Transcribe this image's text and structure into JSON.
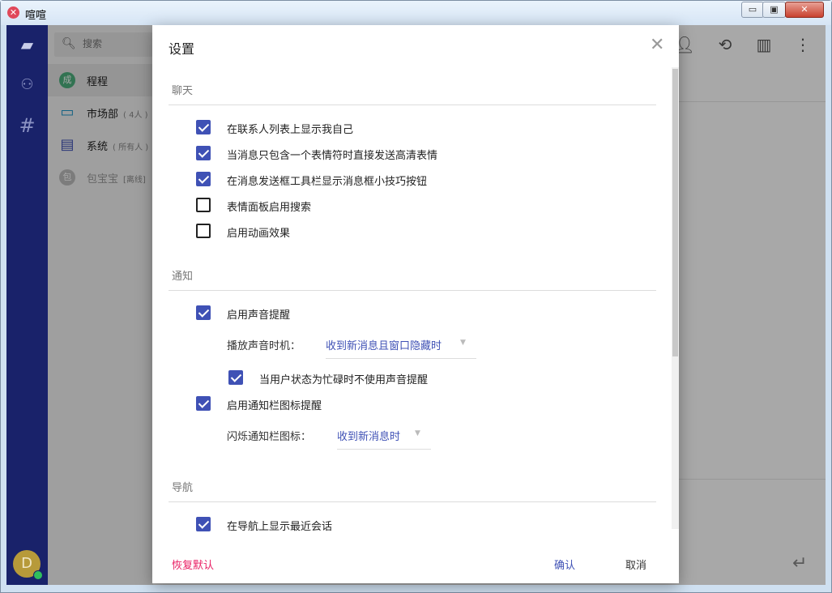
{
  "window": {
    "title": "喧喧",
    "logo": "x-close-icon"
  },
  "sidebar": {
    "items": [
      {
        "name": "chat",
        "icon": "chat-bubble-icon",
        "active": true
      },
      {
        "name": "contacts",
        "icon": "people-icon"
      },
      {
        "name": "channels",
        "icon": "hash-icon"
      }
    ],
    "avatar_letter": "D"
  },
  "chat_list": {
    "search_placeholder": "搜索",
    "items": [
      {
        "name": "程程",
        "avatar_text": "成",
        "avatar_color": "#4caf7d",
        "selected": true
      },
      {
        "name": "市场部",
        "sub": "( 4人 )",
        "icon": "group-chat-icon"
      },
      {
        "name": "系统",
        "sub": "( 所有人 )",
        "icon": "system-chat-icon"
      },
      {
        "name": "包宝宝",
        "sub": "[离线]",
        "avatar_text": "包",
        "avatar_color": "#bdbdbd"
      }
    ]
  },
  "dialog": {
    "title": "设置",
    "sections": [
      {
        "title": "聊天",
        "options": [
          {
            "label": "在联系人列表上显示我自己",
            "checked": true
          },
          {
            "label": "当消息只包含一个表情符时直接发送高清表情",
            "checked": true
          },
          {
            "label": "在消息发送框工具栏显示消息框小技巧按钮",
            "checked": true
          },
          {
            "label": "表情面板启用搜索",
            "checked": false
          },
          {
            "label": "启用动画效果",
            "checked": false
          }
        ]
      },
      {
        "title": "通知",
        "sound_enabled": {
          "label": "启用声音提醒",
          "checked": true
        },
        "sound_timing": {
          "label": "播放声音时机：",
          "value": "收到新消息且窗口隐藏时"
        },
        "busy_mute": {
          "label": "当用户状态为忙碌时不使用声音提醒",
          "checked": true
        },
        "tray_enabled": {
          "label": "启用通知栏图标提醒",
          "checked": true
        },
        "tray_flash": {
          "label": "闪烁通知栏图标：",
          "value": "收到新消息时"
        }
      },
      {
        "title": "导航",
        "options": [
          {
            "label": "在导航上显示最近会话",
            "checked": true
          }
        ]
      }
    ],
    "buttons": {
      "reset": "恢复默认",
      "confirm": "确认",
      "cancel": "取消"
    }
  },
  "colors": {
    "accent": "#3f51b5",
    "danger": "#e91e63",
    "nav_bg": "#19226a"
  }
}
